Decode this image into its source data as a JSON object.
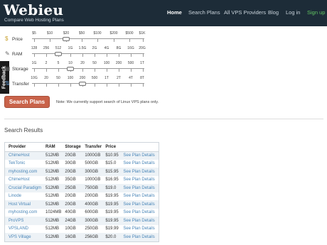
{
  "header": {
    "logo": "Webieu",
    "tagline": "Compare Web Hosting Plans",
    "nav": [
      {
        "label": "Home",
        "active": true
      },
      {
        "label": "Search Plans"
      },
      {
        "label": "All VPS Providers"
      },
      {
        "label": "Blog"
      },
      {
        "label": "Log in"
      },
      {
        "label": "Sign up"
      }
    ]
  },
  "feedback_label": "Feedback",
  "filters": {
    "price": {
      "label": "Price",
      "icon": "money-icon",
      "ticks": [
        "$5",
        "$10",
        "$20",
        "$50",
        "$100",
        "$200",
        "$500",
        "$1K"
      ],
      "selected": "$20"
    },
    "ram": {
      "label": "RAM",
      "icon": "wrench-icon",
      "ticks": [
        "128",
        "256",
        "512",
        "1G",
        "1.5G",
        "2G",
        "4G",
        "8G",
        "16G",
        "20G"
      ],
      "selected": "512"
    },
    "storage": {
      "label": "Storage",
      "icon": "disk-icon",
      "ticks": [
        "1G",
        "2",
        "5",
        "10",
        "20",
        "50",
        "100",
        "200",
        "500",
        "1T"
      ],
      "selected": "10"
    },
    "transfer": {
      "label": "Transfer",
      "icon": "transfer-icon",
      "ticks": [
        "10G",
        "20",
        "50",
        "100",
        "200",
        "500",
        "1T",
        "2T",
        "4T",
        "8T"
      ],
      "selected": "200"
    }
  },
  "search_button": "Search Plans",
  "note": "Note: We currently support search of Linux VPS plans only.",
  "results": {
    "title": "Search Results",
    "columns": [
      "Provider",
      "RAM",
      "Storage",
      "Transfer",
      "Price",
      ""
    ],
    "rows": [
      {
        "provider": "ChimeHost",
        "ram": "512MB",
        "storage": "20GB",
        "transfer": "1000GB",
        "price": "$10.95",
        "action": "See Plan Details"
      },
      {
        "provider": "TekTonic",
        "ram": "512MB",
        "storage": "30GB",
        "transfer": "500GB",
        "price": "$15.0",
        "action": "See Plan Details"
      },
      {
        "provider": "myhosting.com",
        "ram": "512MB",
        "storage": "20GB",
        "transfer": "300GB",
        "price": "$15.95",
        "action": "See Plan Details"
      },
      {
        "provider": "ChimeHost",
        "ram": "512MB",
        "storage": "35GB",
        "transfer": "1000GB",
        "price": "$16.95",
        "action": "See Plan Details"
      },
      {
        "provider": "Crucial Paradigm",
        "ram": "512MB",
        "storage": "25GB",
        "transfer": "750GB",
        "price": "$19.0",
        "action": "See Plan Details"
      },
      {
        "provider": "Linode",
        "ram": "512MB",
        "storage": "20GB",
        "transfer": "200GB",
        "price": "$19.95",
        "action": "See Plan Details"
      },
      {
        "provider": "Host Virtual",
        "ram": "512MB",
        "storage": "20GB",
        "transfer": "400GB",
        "price": "$19.95",
        "action": "See Plan Details"
      },
      {
        "provider": "myhosting.com",
        "ram": "1024MB",
        "storage": "40GB",
        "transfer": "600GB",
        "price": "$19.95",
        "action": "See Plan Details"
      },
      {
        "provider": "ProVPS",
        "ram": "512MB",
        "storage": "24GB",
        "transfer": "300GB",
        "price": "$19.95",
        "action": "See Plan Details"
      },
      {
        "provider": "VPSLAND",
        "ram": "512MB",
        "storage": "10GB",
        "transfer": "250GB",
        "price": "$19.99",
        "action": "See Plan Details"
      },
      {
        "provider": "VPS Village",
        "ram": "512MB",
        "storage": "16GB",
        "transfer": "256GB",
        "price": "$20.0",
        "action": "See Plan Details"
      }
    ]
  },
  "colors": {
    "header_bg": "#1d2c38",
    "button": "#c9634a",
    "link": "#4a86b8",
    "signup": "#62c462"
  }
}
